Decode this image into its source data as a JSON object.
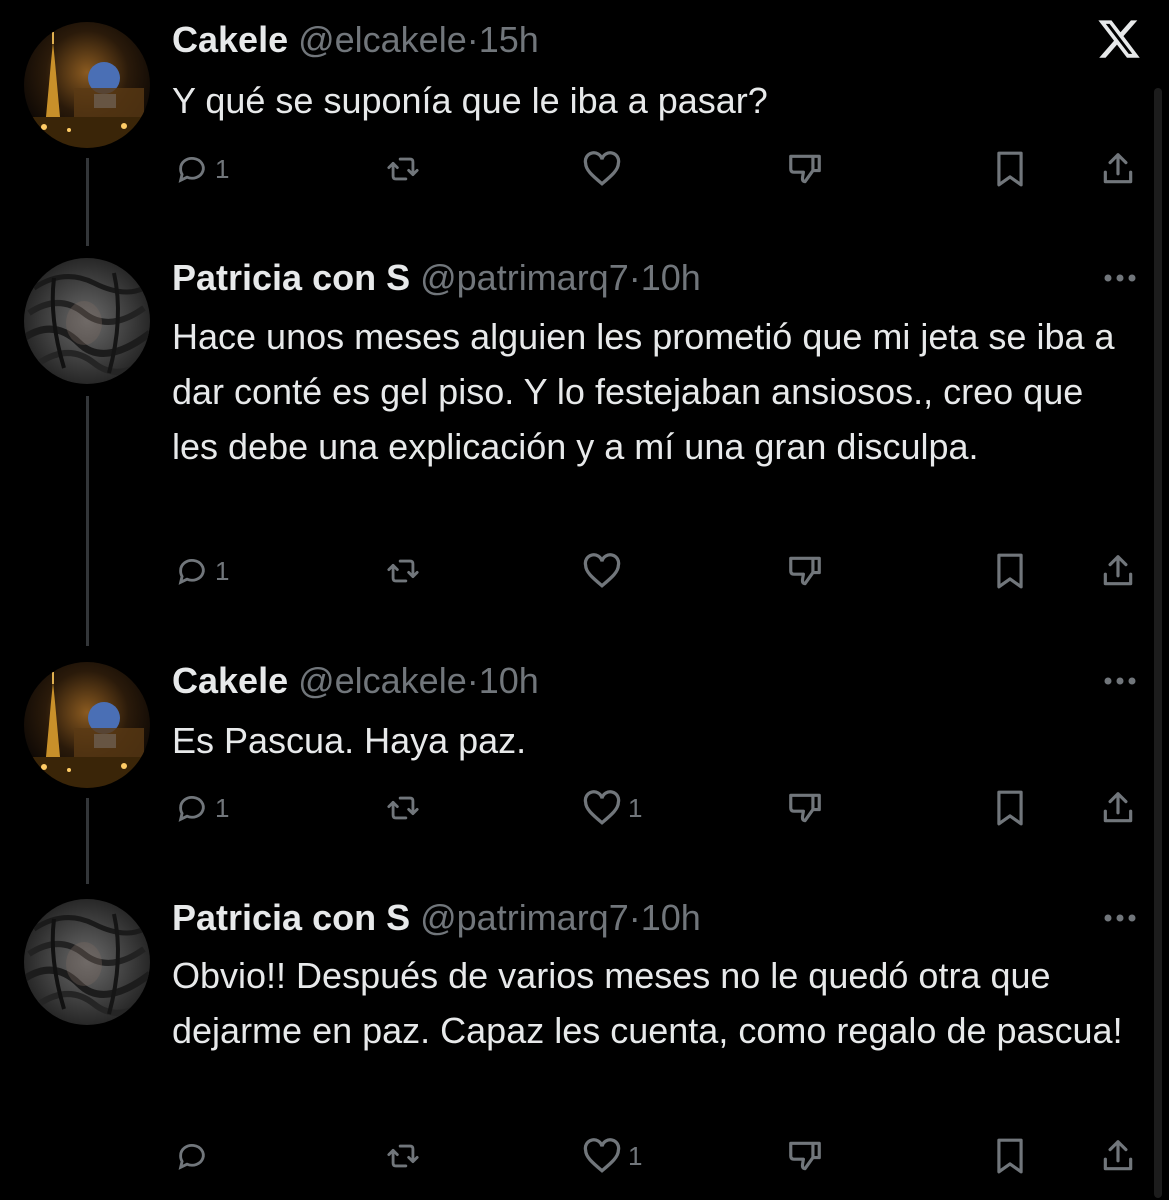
{
  "tweets": [
    {
      "name": "Cakele",
      "handle": "@elcakele",
      "sep": "·",
      "time": "15h",
      "text": "Y qué se suponía que le iba a pasar?",
      "reply_count": "1",
      "like_count": ""
    },
    {
      "name": "Patricia con S",
      "handle": "@patrimarq7",
      "sep": "·",
      "time": "10h",
      "text": "Hace unos meses alguien les prometió que mi jeta se iba a dar conté es gel piso. Y lo festejaban ansiosos., creo que les debe una explicación y a mí una gran disculpa.",
      "reply_count": "1",
      "like_count": ""
    },
    {
      "name": "Cakele",
      "handle": "@elcakele",
      "sep": "·",
      "time": "10h",
      "text": "Es Pascua. Haya paz.",
      "reply_count": "1",
      "like_count": "1"
    },
    {
      "name": "Patricia con S",
      "handle": "@patrimarq7",
      "sep": "·",
      "time": "10h",
      "text": "Obvio!! Después de varios meses no le quedó otra que dejarme en paz. Capaz les cuenta, como regalo de pascua!",
      "reply_count": "",
      "like_count": "1"
    }
  ],
  "icons": {
    "logo": "x-logo-icon",
    "more": "more-icon",
    "reply": "reply-icon",
    "retweet": "retweet-icon",
    "like": "heart-icon",
    "dislike": "dislike-icon",
    "bookmark": "bookmark-icon",
    "share": "share-icon"
  },
  "colors": {
    "background": "#000000",
    "text": "#e7e9ea",
    "muted": "#71767b",
    "thread_line": "#333639"
  }
}
